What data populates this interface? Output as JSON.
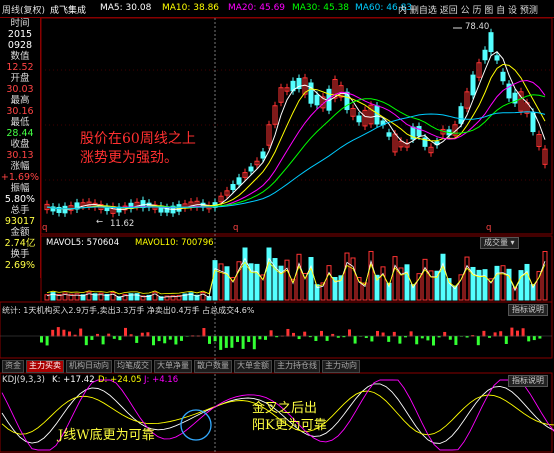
{
  "header": {
    "period": "周线(复权)",
    "stock_name": "成飞集成",
    "ma5": "MA5: 30.08",
    "ma10": "MA10: 38.86",
    "ma20": "MA20: 45.69",
    "ma30": "MA30: 45.38",
    "ma60": "MA60: 46.83",
    "buttons": [
      "公",
      "历",
      "图",
      "自",
      "设",
      "预测"
    ],
    "buttons_text": "内 删自选 返回 公 历 图 自 设 预测"
  },
  "info_panel": {
    "time_label": "时间",
    "year": "2015",
    "date": "0928",
    "value_label": "数值",
    "value": "12.52",
    "open_label": "开盘",
    "open": "30.03",
    "high_label": "最高",
    "high": "30.16",
    "low_label": "最低",
    "low": "28.44",
    "close_label": "收盘",
    "close": "30.13",
    "change_label": "涨幅",
    "change": "+1.69%",
    "amplitude_label": "振幅",
    "amplitude": "5.80%",
    "total_label": "总手",
    "total": "93017",
    "amount_label": "金额",
    "amount": "2.74亿",
    "turnover_label": "换手",
    "turnover": "2.69%"
  },
  "price_chart": {
    "high_label": "78.40",
    "low_label": "11.62",
    "annotation_line1": "股价在60周线之上",
    "annotation_line2": "涨势更为强劲。",
    "marker_q": "q"
  },
  "volume_panel": {
    "mavol5": "MAVOL5: 570604",
    "mavol10": "MAVOL10: 700796",
    "selector": "成交量"
  },
  "fund_panel": {
    "text": "统计: 1天机构买入2.9万手,卖出3.3万手 净卖出0.4万手 占总成交4.6%",
    "help": "指标说明"
  },
  "tabs": [
    "资金",
    "主力买卖",
    "机构日动向",
    "均笔成交",
    "大单净量",
    "散户数量",
    "大单金额",
    "主力持仓线",
    "主力动向"
  ],
  "kdj_panel": {
    "title": "KDJ(9,3,3)",
    "k": "K: +17.42",
    "d": "D: +24.05",
    "j": "J: +4.16",
    "help": "指标说明",
    "annotation_left": "J线W底更为可靠",
    "annotation_right_line1": "金叉之后出",
    "annotation_right_line2": "阳K更为可靠"
  },
  "colors": {
    "up": "#ff3333",
    "down": "#54ffff",
    "ma5": "#ffffff",
    "ma10": "#ffff00",
    "ma20": "#ff00ff",
    "ma30": "#00ff00",
    "ma60": "#00ccff",
    "frame": "#880000"
  }
}
